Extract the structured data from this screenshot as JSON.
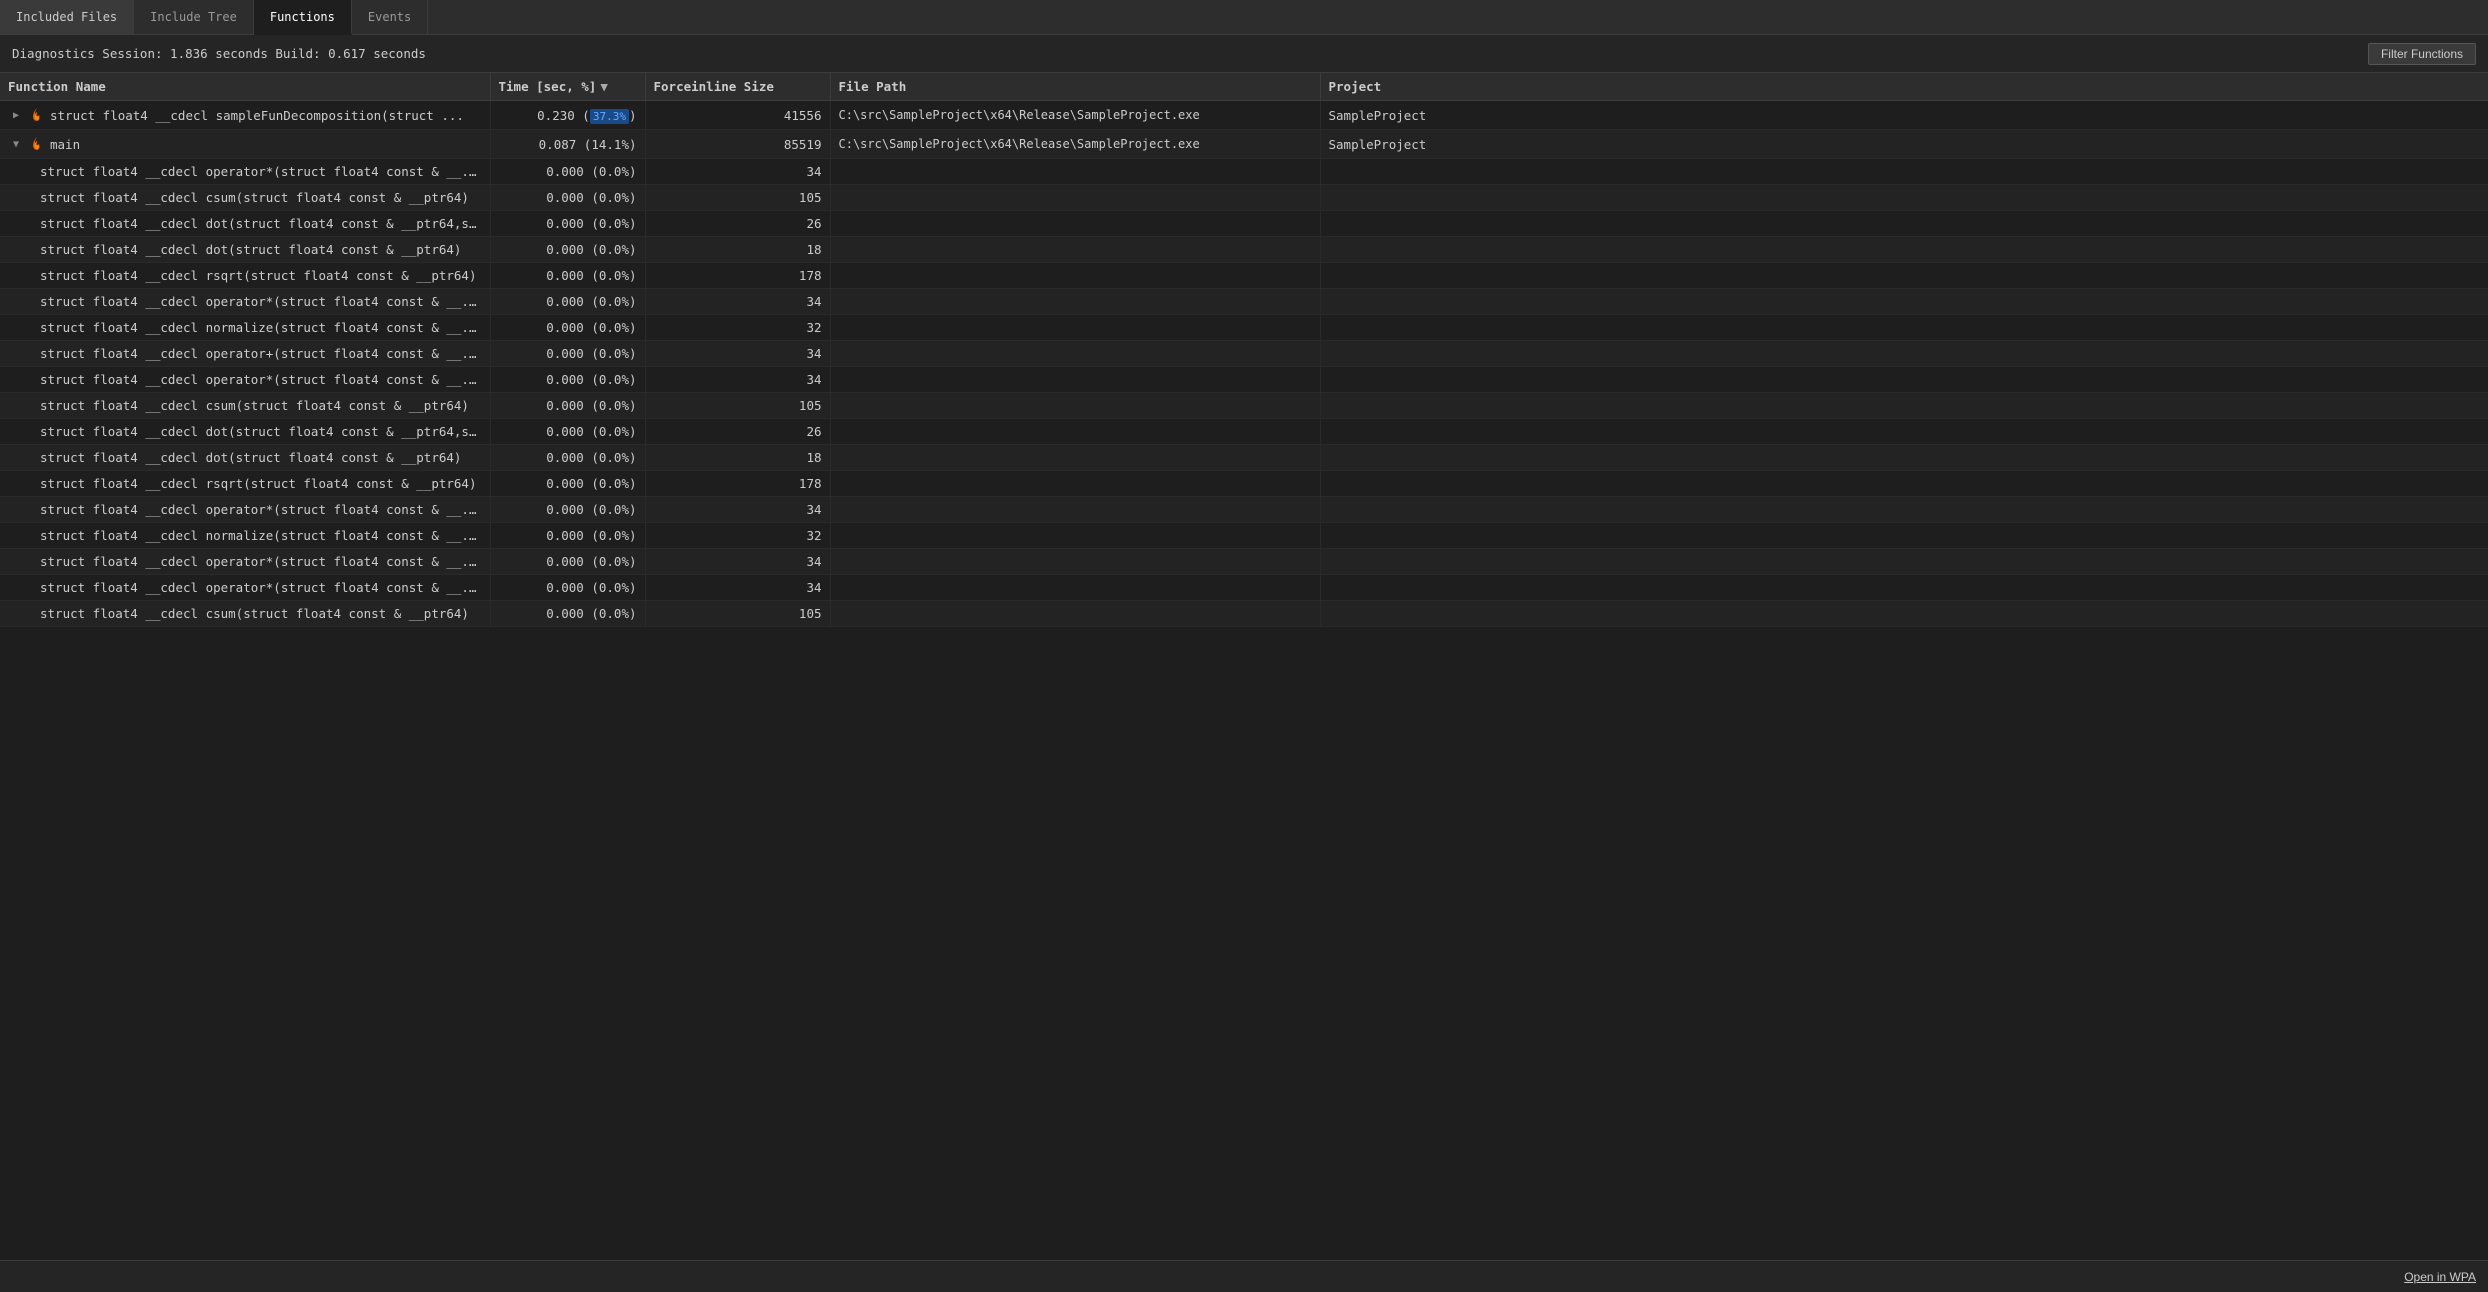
{
  "tabs": [
    {
      "id": "included-files",
      "label": "Included Files",
      "active": false
    },
    {
      "id": "include-tree",
      "label": "Include Tree",
      "active": false
    },
    {
      "id": "functions",
      "label": "Functions",
      "active": true
    },
    {
      "id": "events",
      "label": "Events",
      "active": false
    }
  ],
  "session": {
    "text": "Diagnostics Session: 1.836 seconds  Build: 0.617 seconds"
  },
  "filter_button": "Filter Functions",
  "columns": [
    {
      "id": "name",
      "label": "Function Name",
      "sortable": false
    },
    {
      "id": "time",
      "label": "Time [sec, %]",
      "sortable": true,
      "sort_dir": "desc"
    },
    {
      "id": "force",
      "label": "Forceinline Size",
      "sortable": false
    },
    {
      "id": "path",
      "label": "File Path",
      "sortable": false
    },
    {
      "id": "project",
      "label": "Project",
      "sortable": false
    }
  ],
  "rows": [
    {
      "id": 1,
      "level": 0,
      "expandable": true,
      "expanded": false,
      "has_flame": true,
      "name": "struct float4 __cdecl sampleFunDecomposition(struct ...",
      "time": "0.230",
      "pct": "37.3%",
      "pct_highlight": true,
      "force": "41556",
      "path": "C:\\src\\SampleProject\\x64\\Release\\SampleProject.exe",
      "project": "SampleProject"
    },
    {
      "id": 2,
      "level": 0,
      "expandable": true,
      "expanded": true,
      "has_flame": true,
      "name": "main",
      "time": "0.087",
      "pct": "14.1%",
      "pct_highlight": false,
      "force": "85519",
      "path": "C:\\src\\SampleProject\\x64\\Release\\SampleProject.exe",
      "project": "SampleProject"
    },
    {
      "id": 3,
      "level": 1,
      "expandable": false,
      "expanded": false,
      "has_flame": false,
      "name": "struct float4 __cdecl operator*(struct float4 const & __...",
      "time": "0.000",
      "pct": "0.0%",
      "pct_highlight": false,
      "force": "34",
      "path": "",
      "project": ""
    },
    {
      "id": 4,
      "level": 1,
      "expandable": false,
      "expanded": false,
      "has_flame": false,
      "name": "struct float4 __cdecl csum(struct float4 const & __ptr64)",
      "time": "0.000",
      "pct": "0.0%",
      "pct_highlight": false,
      "force": "105",
      "path": "",
      "project": ""
    },
    {
      "id": 5,
      "level": 1,
      "expandable": false,
      "expanded": false,
      "has_flame": false,
      "name": "struct float4 __cdecl dot(struct float4 const & __ptr64,s...",
      "time": "0.000",
      "pct": "0.0%",
      "pct_highlight": false,
      "force": "26",
      "path": "",
      "project": ""
    },
    {
      "id": 6,
      "level": 1,
      "expandable": false,
      "expanded": false,
      "has_flame": false,
      "name": "struct float4 __cdecl dot(struct float4 const & __ptr64)",
      "time": "0.000",
      "pct": "0.0%",
      "pct_highlight": false,
      "force": "18",
      "path": "",
      "project": ""
    },
    {
      "id": 7,
      "level": 1,
      "expandable": false,
      "expanded": false,
      "has_flame": false,
      "name": "struct float4 __cdecl rsqrt(struct float4 const & __ptr64)",
      "time": "0.000",
      "pct": "0.0%",
      "pct_highlight": false,
      "force": "178",
      "path": "",
      "project": ""
    },
    {
      "id": 8,
      "level": 1,
      "expandable": false,
      "expanded": false,
      "has_flame": false,
      "name": "struct float4 __cdecl operator*(struct float4 const & __...",
      "time": "0.000",
      "pct": "0.0%",
      "pct_highlight": false,
      "force": "34",
      "path": "",
      "project": ""
    },
    {
      "id": 9,
      "level": 1,
      "expandable": false,
      "expanded": false,
      "has_flame": false,
      "name": "struct float4 __cdecl normalize(struct float4 const & __...",
      "time": "0.000",
      "pct": "0.0%",
      "pct_highlight": false,
      "force": "32",
      "path": "",
      "project": ""
    },
    {
      "id": 10,
      "level": 1,
      "expandable": false,
      "expanded": false,
      "has_flame": false,
      "name": "struct float4 __cdecl operator+(struct float4 const & __...",
      "time": "0.000",
      "pct": "0.0%",
      "pct_highlight": false,
      "force": "34",
      "path": "",
      "project": ""
    },
    {
      "id": 11,
      "level": 1,
      "expandable": false,
      "expanded": false,
      "has_flame": false,
      "name": "struct float4 __cdecl operator*(struct float4 const & __...",
      "time": "0.000",
      "pct": "0.0%",
      "pct_highlight": false,
      "force": "34",
      "path": "",
      "project": ""
    },
    {
      "id": 12,
      "level": 1,
      "expandable": false,
      "expanded": false,
      "has_flame": false,
      "name": "struct float4 __cdecl csum(struct float4 const & __ptr64)",
      "time": "0.000",
      "pct": "0.0%",
      "pct_highlight": false,
      "force": "105",
      "path": "",
      "project": ""
    },
    {
      "id": 13,
      "level": 1,
      "expandable": false,
      "expanded": false,
      "has_flame": false,
      "name": "struct float4 __cdecl dot(struct float4 const & __ptr64,s...",
      "time": "0.000",
      "pct": "0.0%",
      "pct_highlight": false,
      "force": "26",
      "path": "",
      "project": ""
    },
    {
      "id": 14,
      "level": 1,
      "expandable": false,
      "expanded": false,
      "has_flame": false,
      "name": "struct float4 __cdecl dot(struct float4 const & __ptr64)",
      "time": "0.000",
      "pct": "0.0%",
      "pct_highlight": false,
      "force": "18",
      "path": "",
      "project": ""
    },
    {
      "id": 15,
      "level": 1,
      "expandable": false,
      "expanded": false,
      "has_flame": false,
      "name": "struct float4 __cdecl rsqrt(struct float4 const & __ptr64)",
      "time": "0.000",
      "pct": "0.0%",
      "pct_highlight": false,
      "force": "178",
      "path": "",
      "project": ""
    },
    {
      "id": 16,
      "level": 1,
      "expandable": false,
      "expanded": false,
      "has_flame": false,
      "name": "struct float4 __cdecl operator*(struct float4 const & __...",
      "time": "0.000",
      "pct": "0.0%",
      "pct_highlight": false,
      "force": "34",
      "path": "",
      "project": ""
    },
    {
      "id": 17,
      "level": 1,
      "expandable": false,
      "expanded": false,
      "has_flame": false,
      "name": "struct float4 __cdecl normalize(struct float4 const & __...",
      "time": "0.000",
      "pct": "0.0%",
      "pct_highlight": false,
      "force": "32",
      "path": "",
      "project": ""
    },
    {
      "id": 18,
      "level": 1,
      "expandable": false,
      "expanded": false,
      "has_flame": false,
      "name": "struct float4 __cdecl operator*(struct float4 const & __...",
      "time": "0.000",
      "pct": "0.0%",
      "pct_highlight": false,
      "force": "34",
      "path": "",
      "project": ""
    },
    {
      "id": 19,
      "level": 1,
      "expandable": false,
      "expanded": false,
      "has_flame": false,
      "name": "struct float4 __cdecl operator*(struct float4 const & __...",
      "time": "0.000",
      "pct": "0.0%",
      "pct_highlight": false,
      "force": "34",
      "path": "",
      "project": ""
    },
    {
      "id": 20,
      "level": 1,
      "expandable": false,
      "expanded": false,
      "has_flame": false,
      "name": "struct float4 __cdecl csum(struct float4 const & __ptr64)",
      "time": "0.000",
      "pct": "0.0%",
      "pct_highlight": false,
      "force": "105",
      "path": "",
      "project": ""
    }
  ],
  "bottom": {
    "open_wpa": "Open in WPA"
  }
}
